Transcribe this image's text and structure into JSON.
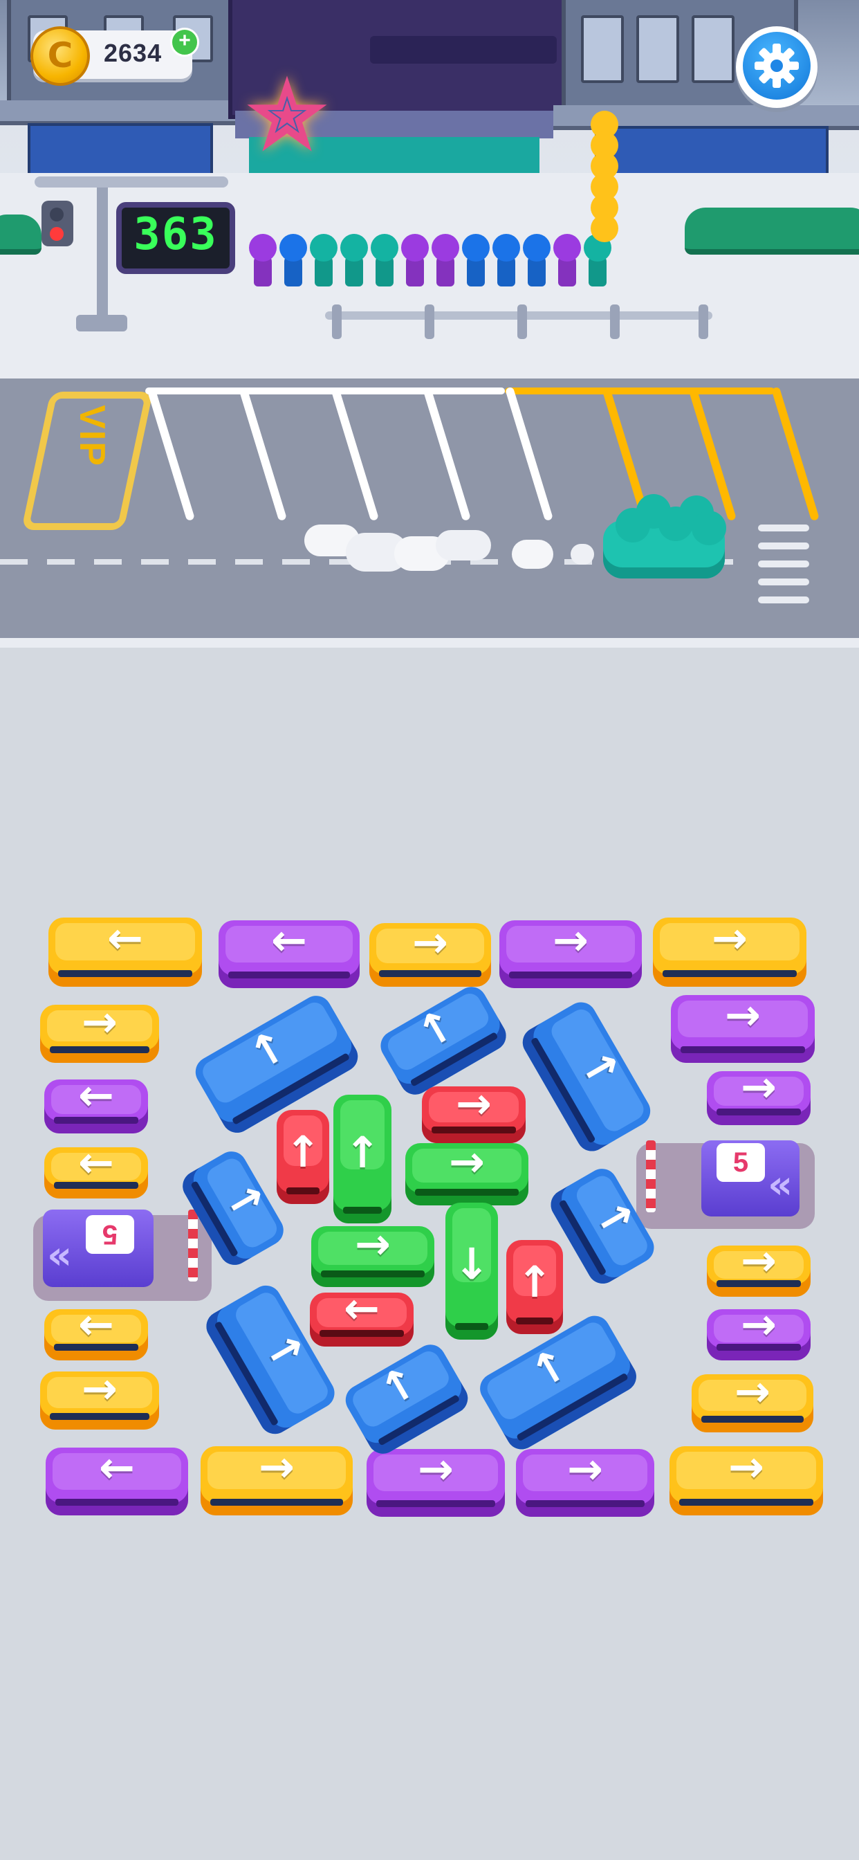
{
  "hud": {
    "coins": "2634",
    "coin_plus": "+",
    "coin_symbol": "C",
    "queue_counter": "363",
    "settings_icon": "gear-icon"
  },
  "road": {
    "vip_label": "VIP"
  },
  "queue": {
    "people_colors": [
      "#9b3be0",
      "#1b73e8",
      "#14b3a2",
      "#14b3a2",
      "#14b3a2",
      "#9b3be0",
      "#9b3be0",
      "#1b73e8",
      "#1b73e8",
      "#1b73e8",
      "#9b3be0",
      "#14b3a2"
    ],
    "stacked_people_color": "#ffc21a"
  },
  "departing_car": {
    "color": "#1ec3b0",
    "passengers_color": "#18b8a6"
  },
  "tunnels": [
    {
      "name": "tunnel-right",
      "count": "5"
    },
    {
      "name": "tunnel-left",
      "count": "5"
    }
  ],
  "colors": {
    "yellow": "#ffc21a",
    "purple": "#b04df0",
    "blue": "#2e7fe8",
    "green": "#2fcf4a",
    "red": "#f03a48"
  },
  "vehicles": [
    {
      "name": "bus-top-1",
      "color": "y",
      "dir": "←"
    },
    {
      "name": "bus-top-2",
      "color": "p",
      "dir": "←"
    },
    {
      "name": "bus-top-3",
      "color": "y",
      "dir": "→"
    },
    {
      "name": "bus-top-4",
      "color": "p",
      "dir": "→"
    },
    {
      "name": "bus-top-5",
      "color": "y",
      "dir": "→"
    },
    {
      "name": "van-left-1",
      "color": "y",
      "dir": "→"
    },
    {
      "name": "car-left-2",
      "color": "p",
      "dir": "←"
    },
    {
      "name": "car-left-3",
      "color": "y",
      "dir": "←"
    },
    {
      "name": "car-left-4",
      "color": "y",
      "dir": "←"
    },
    {
      "name": "van-left-5",
      "color": "y",
      "dir": "→"
    },
    {
      "name": "van-right-1",
      "color": "p",
      "dir": "→"
    },
    {
      "name": "car-right-2",
      "color": "p",
      "dir": "→"
    },
    {
      "name": "car-right-3",
      "color": "y",
      "dir": "→"
    },
    {
      "name": "car-right-4",
      "color": "p",
      "dir": "→"
    },
    {
      "name": "van-right-5",
      "color": "y",
      "dir": "→"
    },
    {
      "name": "bus-bottom-1",
      "color": "p",
      "dir": "←"
    },
    {
      "name": "bus-bottom-2",
      "color": "y",
      "dir": "→"
    },
    {
      "name": "bus-bottom-3",
      "color": "p",
      "dir": "→"
    },
    {
      "name": "bus-bottom-4",
      "color": "p",
      "dir": "→"
    },
    {
      "name": "bus-bottom-5",
      "color": "y",
      "dir": "→"
    },
    {
      "name": "blue-bus-a",
      "color": "b",
      "dir": "↑"
    },
    {
      "name": "blue-van-b",
      "color": "b",
      "dir": "↑"
    },
    {
      "name": "blue-bus-c",
      "color": "b",
      "dir": "↑"
    },
    {
      "name": "blue-van-d",
      "color": "b",
      "dir": "↑"
    },
    {
      "name": "red-car-e",
      "color": "r",
      "dir": "↑"
    },
    {
      "name": "green-bus-f",
      "color": "g",
      "dir": "↑"
    },
    {
      "name": "red-car-g",
      "color": "r",
      "dir": "→"
    },
    {
      "name": "green-bus-h",
      "color": "g",
      "dir": "→"
    },
    {
      "name": "blue-van-i",
      "color": "b",
      "dir": "↑"
    },
    {
      "name": "green-bus-j",
      "color": "g",
      "dir": "→"
    },
    {
      "name": "green-bus-k",
      "color": "g",
      "dir": "↓"
    },
    {
      "name": "red-car-l",
      "color": "r",
      "dir": "↑"
    },
    {
      "name": "blue-bus-m",
      "color": "b",
      "dir": "↑"
    },
    {
      "name": "red-car-n",
      "color": "r",
      "dir": "←"
    },
    {
      "name": "blue-van-o",
      "color": "b",
      "dir": "↑"
    },
    {
      "name": "blue-bus-p",
      "color": "b",
      "dir": "↑"
    }
  ]
}
